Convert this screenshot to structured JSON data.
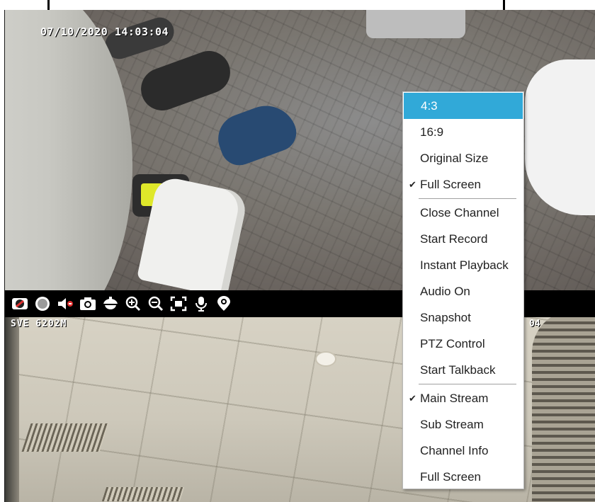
{
  "overlay": {
    "timestamp": "07/10/2020 14:03:04"
  },
  "feed_bottom": {
    "label_left": "SVE 6202M",
    "label_right": "04"
  },
  "toolbar": {
    "icons": [
      "camera-stream-icon",
      "record-icon",
      "mute-icon",
      "snapshot-icon",
      "ptz-dome-icon",
      "zoom-in-icon",
      "zoom-out-icon",
      "fullscreen-icon",
      "microphone-icon",
      "location-settings-icon"
    ]
  },
  "context_menu": {
    "items": [
      {
        "label": "4:3",
        "active": true,
        "checked": false
      },
      {
        "label": "16:9",
        "active": false,
        "checked": false
      },
      {
        "label": "Original Size",
        "active": false,
        "checked": false
      },
      {
        "label": "Full Screen",
        "active": false,
        "checked": true
      },
      {
        "label": "Close Channel",
        "active": false,
        "checked": false
      },
      {
        "label": "Start Record",
        "active": false,
        "checked": false
      },
      {
        "label": "Instant Playback",
        "active": false,
        "checked": false
      },
      {
        "label": "Audio On",
        "active": false,
        "checked": false
      },
      {
        "label": "Snapshot",
        "active": false,
        "checked": false
      },
      {
        "label": "PTZ Control",
        "active": false,
        "checked": false
      },
      {
        "label": "Start Talkback",
        "active": false,
        "checked": false
      },
      {
        "label": "Main Stream",
        "active": false,
        "checked": true
      },
      {
        "label": "Sub Stream",
        "active": false,
        "checked": false
      },
      {
        "label": "Channel Info",
        "active": false,
        "checked": false
      },
      {
        "label": "Full Screen",
        "active": false,
        "checked": false
      }
    ],
    "check_mark": "✔",
    "accent_color": "#31a9d8"
  }
}
